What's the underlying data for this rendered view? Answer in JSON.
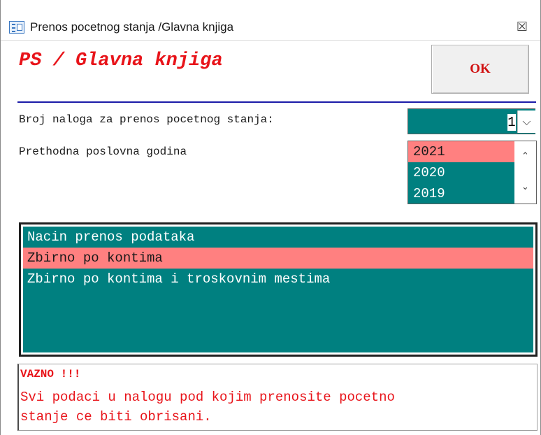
{
  "window": {
    "title": "Prenos pocetnog stanja /Glavna knjiga",
    "close_glyph": "☒"
  },
  "header": {
    "heading": "PS / Glavna knjiga",
    "ok_label": "OK"
  },
  "form": {
    "broj_label": "Broj naloga za prenos pocetnog stanja:",
    "broj_value": "1",
    "godina_label": "Prethodna poslovna godina",
    "years": [
      "2021",
      "2020",
      "2019"
    ],
    "selected_year": "2021"
  },
  "method": {
    "header": "Nacin prenos podataka",
    "options": [
      "Zbirno po kontima",
      "Zbirno po kontima i troskovnim mestima"
    ],
    "selected": "Zbirno po kontima"
  },
  "note": {
    "title": "VAZNO !!!",
    "line1": "Svi podaci u nalogu pod kojim prenosite pocetno",
    "line2": "stanje ce biti obrisani."
  },
  "colors": {
    "teal": "#008080",
    "selected": "#ff8080",
    "red_text": "#e8141a",
    "divider": "#1a1aa8"
  },
  "icons": {
    "window_icon": "form-icon",
    "combo_arrow": "chevron-down-icon",
    "scroll_up": "chevron-up-icon",
    "scroll_down": "chevron-down-icon"
  }
}
